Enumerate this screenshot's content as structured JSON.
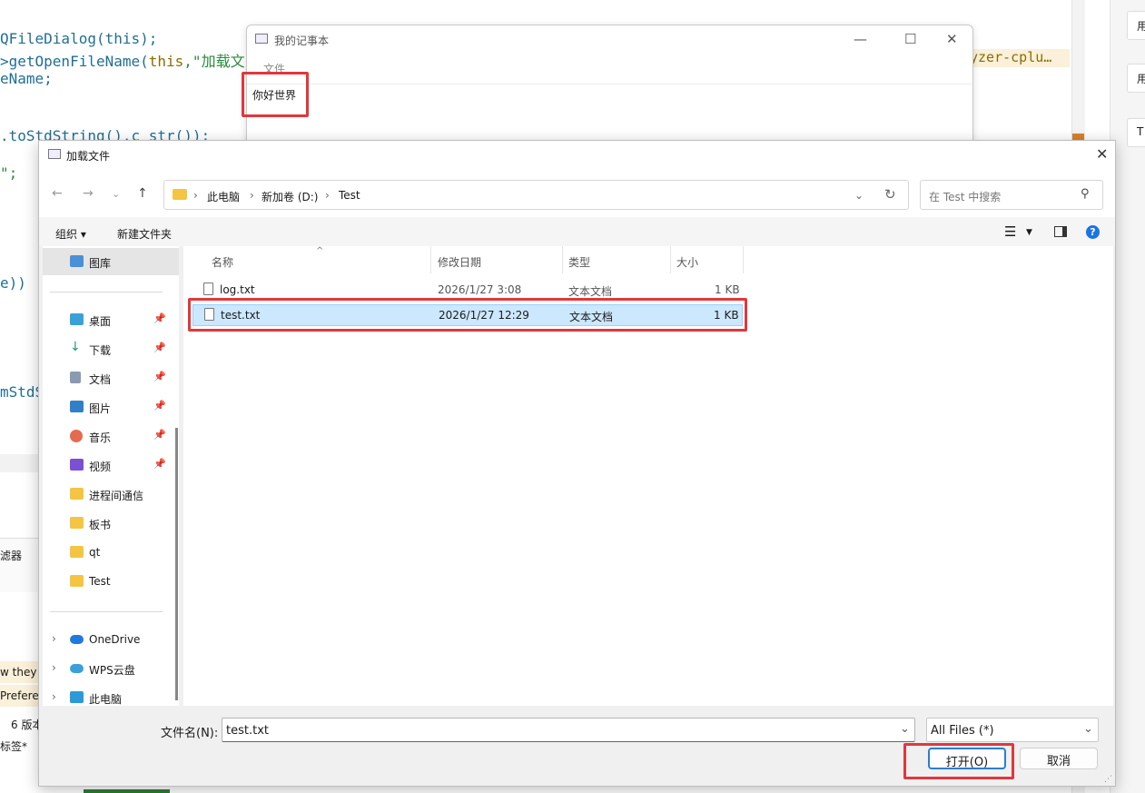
{
  "editor": {
    "code_line1": "QFileDialog(this);",
    "code_line2_a": ">getOpenFileName(",
    "code_line2_b": "this",
    "code_line2_c": ",\"加载文",
    "code_line3": "eName;",
    "code_line4": ".toStdString().c_str());",
    "code_line5": "\";",
    "code_line6": "e))",
    "code_line7": "mStdS",
    "hint_text": "yzer-cplu…",
    "panel_filter": "滤器",
    "panel_line1": "w they a",
    "panel_line2": "Preferen",
    "panel_line3": "6 版本",
    "panel_line4": "标签*"
  },
  "right_panel": {
    "tab1": "用",
    "tab2": "用",
    "tab3": "T"
  },
  "notepad": {
    "title": "我的记事本",
    "menu_file": "文件",
    "content": "你好世界"
  },
  "dialog": {
    "title": "加载文件",
    "breadcrumb": [
      "此电脑",
      "新加卷 (D:)",
      "Test"
    ],
    "search_placeholder": "在 Test 中搜索",
    "toolbar": {
      "organize": "组织 ▾",
      "new_folder": "新建文件夹"
    },
    "sidebar": {
      "gallery": "图库",
      "desktop": "桌面",
      "downloads": "下载",
      "documents": "文档",
      "pictures": "图片",
      "music": "音乐",
      "videos": "视频",
      "folder_ipc": "进程间通信",
      "folder_board": "板书",
      "folder_qt": "qt",
      "folder_test": "Test",
      "onedrive": "OneDrive",
      "wps": "WPS云盘",
      "this_pc": "此电脑"
    },
    "columns": {
      "name": "名称",
      "modified": "修改日期",
      "type": "类型",
      "size": "大小"
    },
    "files": [
      {
        "name": "log.txt",
        "modified": "2026/1/27 3:08",
        "type": "文本文档",
        "size": "1 KB"
      },
      {
        "name": "test.txt",
        "modified": "2026/1/27 12:29",
        "type": "文本文档",
        "size": "1 KB"
      }
    ],
    "filename_label": "文件名(N):",
    "filename_value": "test.txt",
    "filter_value": "All Files (*)",
    "open_button": "打开(O)",
    "cancel_button": "取消"
  },
  "colors": {
    "highlight_red": "#e0383c",
    "selection_blue": "#cce8ff",
    "help_blue": "#1a73e8"
  }
}
